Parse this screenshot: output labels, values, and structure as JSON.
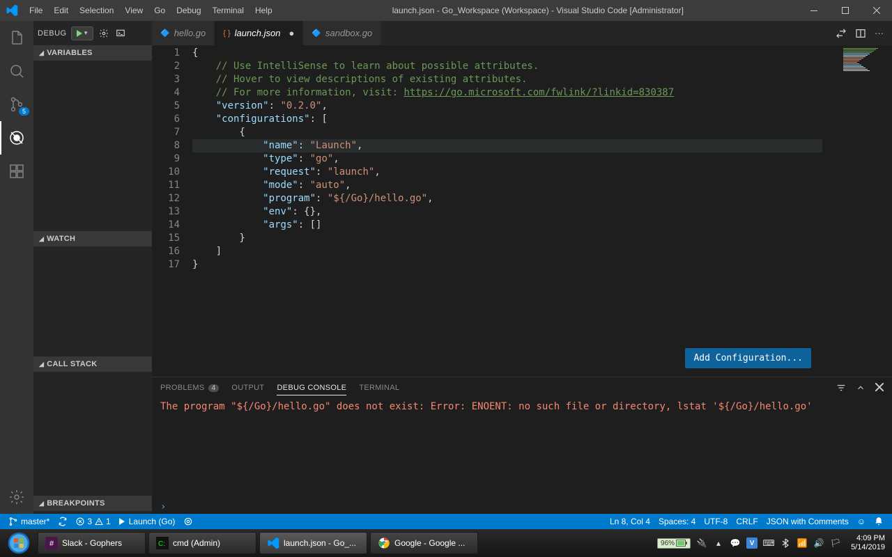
{
  "titlebar": {
    "menu": [
      "File",
      "Edit",
      "Selection",
      "View",
      "Go",
      "Debug",
      "Terminal",
      "Help"
    ],
    "title": "launch.json - Go_Workspace (Workspace) - Visual Studio Code [Administrator]"
  },
  "activitybar": {
    "scm_badge": "5"
  },
  "debug": {
    "label": "DEBUG",
    "sections": [
      "VARIABLES",
      "WATCH",
      "CALL STACK",
      "BREAKPOINTS"
    ]
  },
  "tabs": [
    {
      "icon": "go",
      "label": "hello.go",
      "active": false,
      "dirty": false
    },
    {
      "icon": "json",
      "label": "launch.json",
      "active": true,
      "dirty": true
    },
    {
      "icon": "go",
      "label": "sandbox.go",
      "active": false,
      "dirty": false
    }
  ],
  "editor": {
    "lines": 17,
    "code": [
      "{",
      "    // Use IntelliSense to learn about possible attributes.",
      "    // Hover to view descriptions of existing attributes.",
      {
        "pre": "    // For more information, visit: ",
        "link": "https://go.microsoft.com/fwlink/?linkid=830387"
      },
      {
        "key": "\"version\"",
        "sep": ": ",
        "val": "\"0.2.0\"",
        "tail": ","
      },
      {
        "key": "\"configurations\"",
        "sep": ": ",
        "val": "[",
        "bracket": true
      },
      "        {",
      {
        "pad": "            ",
        "key": "\"name\"",
        "sep": ": ",
        "val": "\"Launch\"",
        "tail": ","
      },
      {
        "pad": "            ",
        "key": "\"type\"",
        "sep": ": ",
        "val": "\"go\"",
        "tail": ","
      },
      {
        "pad": "            ",
        "key": "\"request\"",
        "sep": ": ",
        "val": "\"launch\"",
        "tail": ","
      },
      {
        "pad": "            ",
        "key": "\"mode\"",
        "sep": ": ",
        "val": "\"auto\"",
        "tail": ","
      },
      {
        "pad": "            ",
        "key": "\"program\"",
        "sep": ": ",
        "val": "\"${/Go}/hello.go\"",
        "tail": ","
      },
      {
        "pad": "            ",
        "key": "\"env\"",
        "sep": ": ",
        "val": "{}",
        "plain": true,
        "tail": ","
      },
      {
        "pad": "            ",
        "key": "\"args\"",
        "sep": ": ",
        "val": "[]",
        "plain": true
      },
      "        }",
      "    ]",
      "}"
    ],
    "cursor_line": 8,
    "add_button": "Add Configuration..."
  },
  "panel": {
    "tabs": [
      {
        "label": "PROBLEMS",
        "count": "4"
      },
      {
        "label": "OUTPUT"
      },
      {
        "label": "DEBUG CONSOLE",
        "active": true
      },
      {
        "label": "TERMINAL"
      }
    ],
    "error": "The program \"${/Go}/hello.go\" does not exist: Error: ENOENT: no such file or directory, lstat '${/Go}/hello.go'",
    "prompt": "›"
  },
  "statusbar": {
    "branch": "master*",
    "errors": "3",
    "warnings": "1",
    "launch": "Launch (Go)",
    "pos": "Ln 8, Col 4",
    "spaces": "Spaces: 4",
    "encoding": "UTF-8",
    "eol": "CRLF",
    "lang": "JSON with Comments"
  },
  "taskbar": {
    "items": [
      {
        "label": "Slack - Gophers"
      },
      {
        "label": "cmd (Admin)"
      },
      {
        "label": "launch.json - Go_...",
        "active": true
      },
      {
        "label": "Google - Google ..."
      }
    ],
    "battery": "96%",
    "time": "4:09 PM",
    "date": "5/14/2019"
  }
}
